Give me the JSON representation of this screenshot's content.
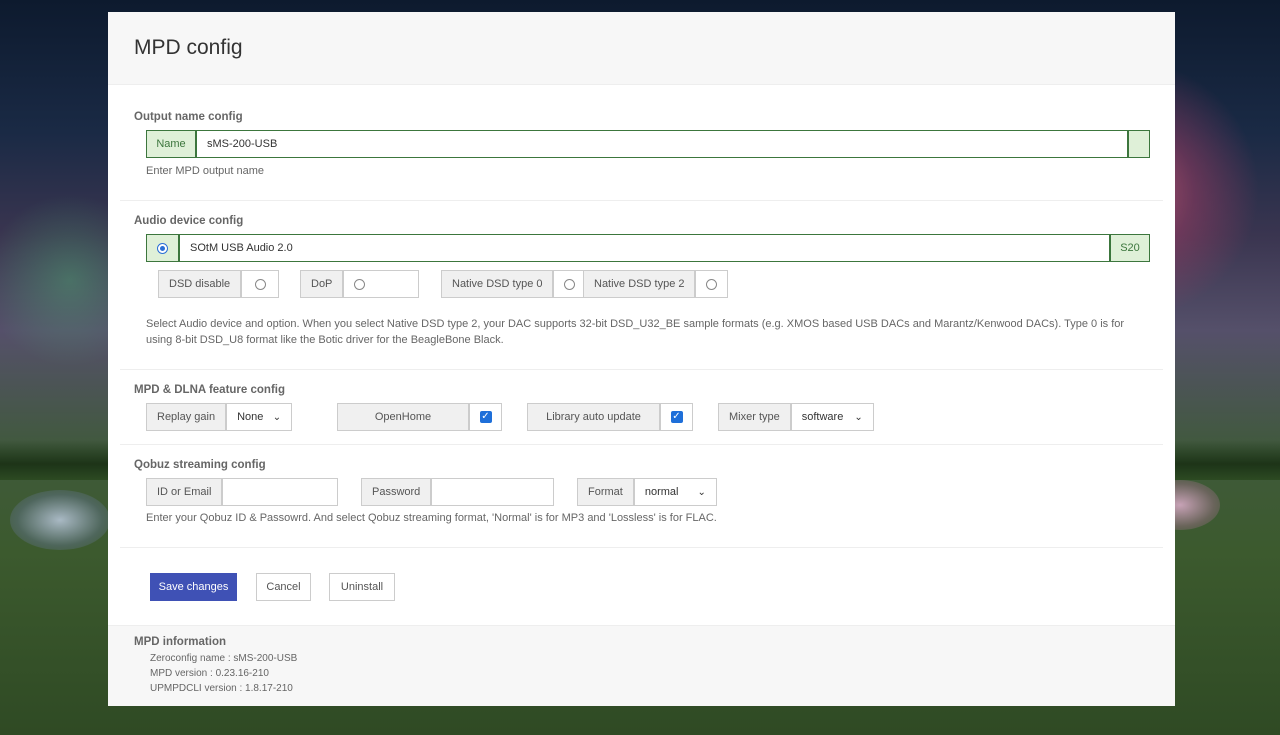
{
  "page": {
    "title": "MPD config"
  },
  "output": {
    "section_title": "Output name config",
    "name_label": "Name",
    "name_value": "sMS-200-USB",
    "help": "Enter MPD output name"
  },
  "audio": {
    "section_title": "Audio device config",
    "device": "SOtM USB Audio 2.0",
    "device_tag": "S20",
    "dsd_options": [
      "DSD disable",
      "DoP",
      "Native DSD type 0",
      "Native DSD type 2"
    ],
    "help": "Select Audio device and option. When you select Native DSD type 2, your DAC supports 32-bit DSD_U32_BE sample formats (e.g. XMOS based USB DACs and Marantz/Kenwood DACs). Type 0 is for using 8-bit DSD_U8 format like the Botic driver for the BeagleBone Black."
  },
  "feature": {
    "section_title": "MPD & DLNA feature config",
    "replay_gain_label": "Replay gain",
    "replay_gain_value": "None",
    "openhome_label": "OpenHome",
    "library_label": "Library auto update",
    "mixer_label": "Mixer type",
    "mixer_value": "software"
  },
  "qobuz": {
    "section_title": "Qobuz streaming config",
    "id_label": "ID or Email",
    "password_label": "Password",
    "format_label": "Format",
    "format_value": "normal",
    "help": "Enter your Qobuz ID & Passowrd. And select Qobuz streaming format, 'Normal' is for MP3 and 'Lossless' is for FLAC."
  },
  "buttons": {
    "save": "Save changes",
    "cancel": "Cancel",
    "uninstall": "Uninstall"
  },
  "info": {
    "title": "MPD information",
    "lines": [
      "Zeroconfig name : sMS-200-USB",
      "MPD version : 0.23.16-210",
      "UPMPDCLI version : 1.8.17-210"
    ]
  },
  "colors": {
    "primary": "#3f51b5",
    "success": "#3c763d",
    "checkbox": "#1e6fd9"
  }
}
